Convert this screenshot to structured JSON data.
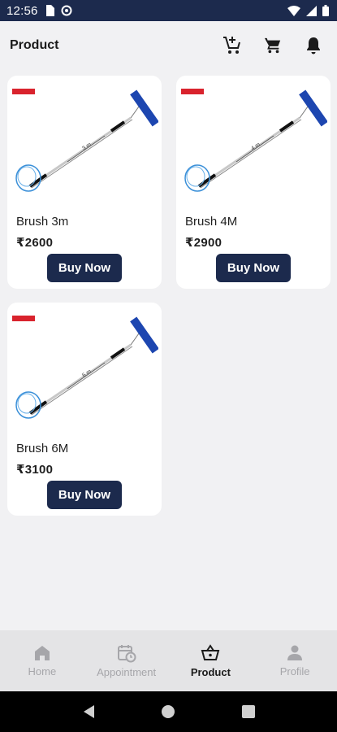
{
  "status_bar": {
    "time": "12:56",
    "icons": [
      "sim-card-icon",
      "data-saver-icon",
      "wifi-icon",
      "signal-icon",
      "battery-icon"
    ]
  },
  "header": {
    "title": "Product",
    "icons": [
      "cart-add-icon",
      "cart-icon",
      "bell-icon"
    ]
  },
  "products": [
    {
      "name": "Brush 3m",
      "price": "₹2600",
      "button": "Buy Now",
      "length_label": "3 m"
    },
    {
      "name": "Brush 4M",
      "price": "₹2900",
      "button": "Buy Now",
      "length_label": "4 m"
    },
    {
      "name": "Brush 6M",
      "price": "₹3100",
      "button": "Buy Now",
      "length_label": "6 m"
    }
  ],
  "bottom_nav": {
    "items": [
      {
        "label": "Home",
        "icon": "home-icon",
        "active": false
      },
      {
        "label": "Appointment",
        "icon": "calendar-clock-icon",
        "active": false
      },
      {
        "label": "Product",
        "icon": "basket-icon",
        "active": true
      },
      {
        "label": "Profile",
        "icon": "person-icon",
        "active": false
      }
    ]
  },
  "colors": {
    "primary": "#1c2a4d",
    "background": "#f1f1f3",
    "card": "#ffffff",
    "inactive": "#a6a6aa",
    "brush_blue": "#1d46b0"
  }
}
